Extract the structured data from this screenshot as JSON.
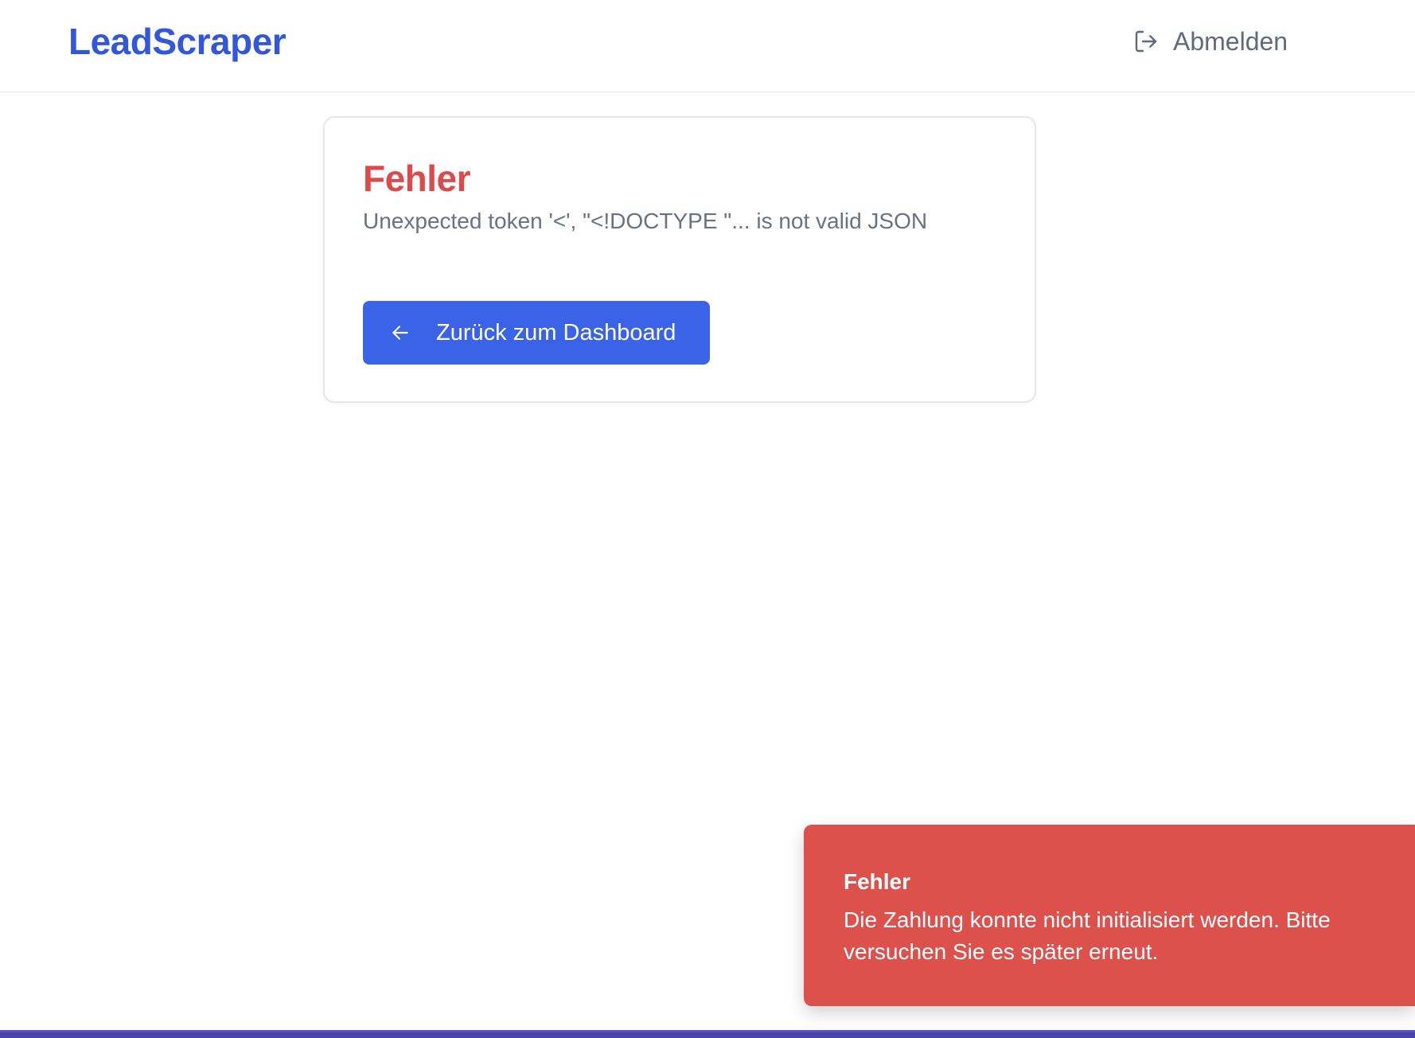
{
  "header": {
    "brand": "LeadScraper",
    "logout_label": "Abmelden"
  },
  "error_card": {
    "title": "Fehler",
    "message": "Unexpected token '<', \"<!DOCTYPE \"... is not valid JSON",
    "back_button_label": "Zurück zum Dashboard"
  },
  "toast": {
    "title": "Fehler",
    "message": "Die Zahlung konnte nicht initialisiert werden. Bitte versuchen Sie es später erneut."
  },
  "colors": {
    "brand": "#3257dd",
    "error": "#dc4b4b",
    "primary_button": "#3a63e8",
    "toast_background": "#dd514d"
  },
  "icons": {
    "logout": "logout-icon",
    "back": "arrow-left-icon"
  }
}
